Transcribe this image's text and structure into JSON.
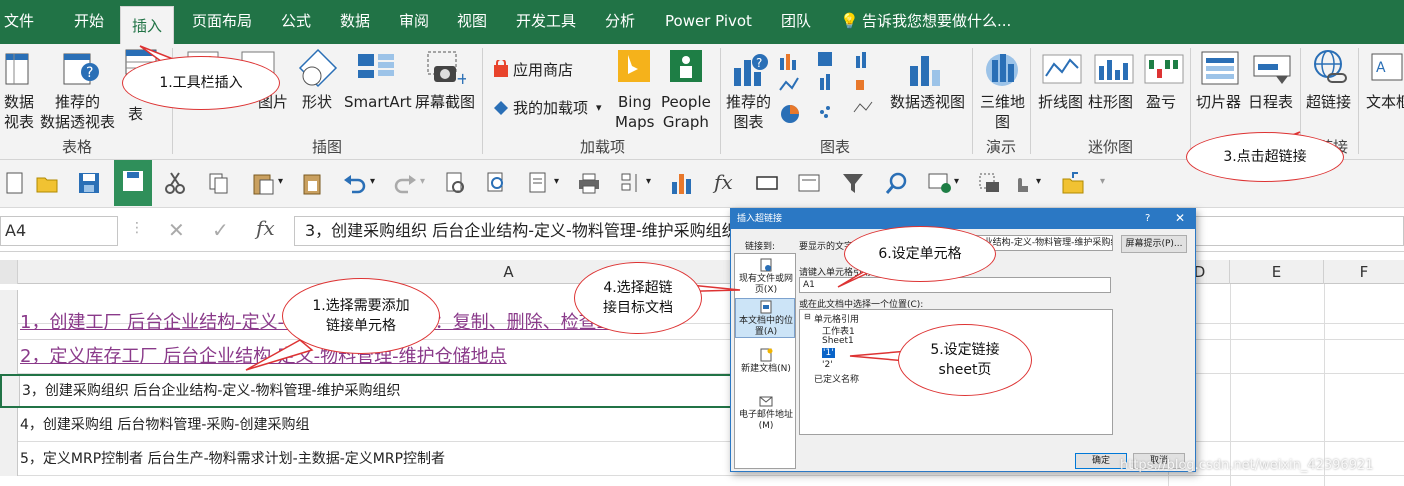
{
  "ribbon_tabs": [
    "文件",
    "开始",
    "插入",
    "页面布局",
    "公式",
    "数据",
    "审阅",
    "视图",
    "开发工具",
    "分析",
    "Power Pivot",
    "团队",
    "告诉我您想要做什么..."
  ],
  "ribbon": {
    "pivot_partial": "数据\n视表",
    "recommended_pivot": "推荐的\n数据透视表",
    "table_partial": "表",
    "group_tables": "表格",
    "pictures_partial": "图片",
    "shapes": "形状",
    "smartart": "SmartArt",
    "screenshot": "屏幕截图",
    "group_illustrations": "插图",
    "store": "应用商店",
    "my_addins": "我的加载项",
    "bing_maps": "Bing\nMaps",
    "people_graph": "People\nGraph",
    "group_addins": "加载项",
    "recommended_charts": "推荐的\n图表",
    "pivot_chart": "数据透视图",
    "group_charts": "图表",
    "map3d": "三维地\n图",
    "group_tours": "演示",
    "line": "折线图",
    "column": "柱形图",
    "winloss": "盈亏",
    "group_sparklines": "迷你图",
    "slicer": "切片器",
    "timeline": "日程表",
    "hyperlink": "超链接",
    "group_links_partial": "链接",
    "textbox_partial": "文本框"
  },
  "formula_bar": {
    "name_box": "A4",
    "content": "3，创建采购组织 后台企业结构-定义-物料管理-维护采购组织"
  },
  "columns": [
    "A",
    "D",
    "E",
    "F"
  ],
  "rows": [
    {
      "text": "1，创建工厂 后台企业结构-定义-物料管理-维护工厂：复制、删除、检查工厂",
      "link": true
    },
    {
      "text": "2，定义库存工厂 后台企业结构-定义-物料管理-维护仓储地点",
      "link": true
    },
    {
      "text": "3，创建采购组织 后台企业结构-定义-物料管理-维护采购组织",
      "link": false
    },
    {
      "text": "4，创建采购组 后台物料管理-采购-创建采购组",
      "link": false
    },
    {
      "text": "5，定义MRP控制者 后台生产-物料需求计划-主数据-定义MRP控制者",
      "link": false
    }
  ],
  "dialog": {
    "title": "插入超链接",
    "help": "?",
    "link_to_label": "链接到:",
    "text_label": "要显示的文字(T):",
    "text_value": "3，创建采购组织 后台企业结构-定义-物料管理-维护采购组织",
    "screentip": "屏幕提示(P)...",
    "cell_ref_label": "请键入单元格引用(E):",
    "cell_ref_value": "A1",
    "place_label": "或在此文档中选择一个位置(C):",
    "tree": [
      "单元格引用",
      "工作表1",
      "Sheet1",
      "'1'",
      "'2'",
      "已定义名称"
    ],
    "side": [
      "现有文件或网页(X)",
      "本文档中的位置(A)",
      "新建文档(N)",
      "电子邮件地址(M)"
    ],
    "ok": "确定",
    "cancel": "取消"
  },
  "callouts": {
    "c1": "1.工具栏插入",
    "c3": "3.点击超链接",
    "c_select": "1.选择需要添加\n链接单元格",
    "c4": "4.选择超链\n接目标文档",
    "c6": "6.设定单元格",
    "c5": "5.设定链接\nsheet页"
  },
  "watermark": "https://blog.csdn.net/weixin_42396921",
  "colors": {
    "excel_green": "#217346",
    "link_purple": "#8a3a8a",
    "callout_red": "#dd3333",
    "dialog_blue": "#2b78c4"
  }
}
